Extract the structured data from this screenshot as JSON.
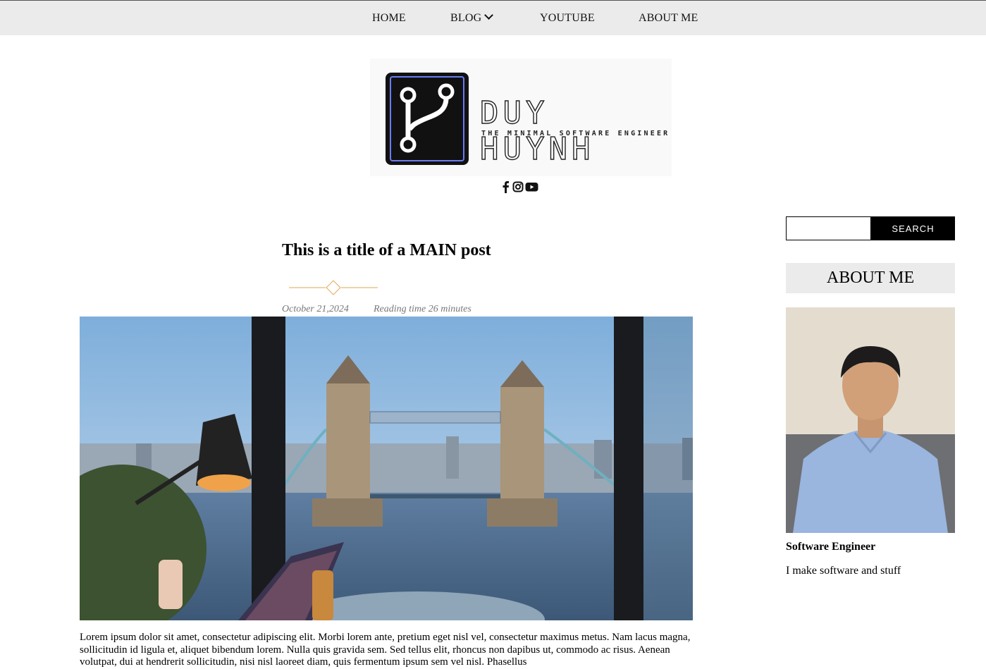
{
  "nav": {
    "home": "HOME",
    "blog": "BLOG",
    "youtube": "YOUTUBE",
    "about": "ABOUT ME"
  },
  "logo": {
    "name": "DUY HUYNH",
    "tagline": "THE MINIMAL SOFTWARE ENGINEER",
    "accent_color": "#6b7cf5"
  },
  "social": {
    "icons": [
      "facebook-icon",
      "instagram-icon",
      "youtube-icon"
    ]
  },
  "post": {
    "title": "This is a title of a MAIN post",
    "date": "October 21,2024",
    "reading_time": "Reading time 26 minutes",
    "divider_color": "#e0a851",
    "excerpt": "Lorem ipsum dolor sit amet, consectetur adipiscing elit. Morbi lorem ante, pretium eget nisl vel, consectetur maximus metus. Nam lacus magna, sollicitudin id ligula et, aliquet bibendum lorem. Nulla quis gravida sem. Sed tellus elit, rhoncus non dapibus ut, commodo ac risus. Aenean volutpat, dui at hendrerit sollicitudin, nisi nisl laoreet diam, quis fermentum ipsum sem vel nisl. Phasellus"
  },
  "sidebar": {
    "search_placeholder": "",
    "search_button": "SEARCH",
    "about_heading": "ABOUT ME",
    "role": "Software Engineer",
    "description": "I make software and stuff"
  }
}
